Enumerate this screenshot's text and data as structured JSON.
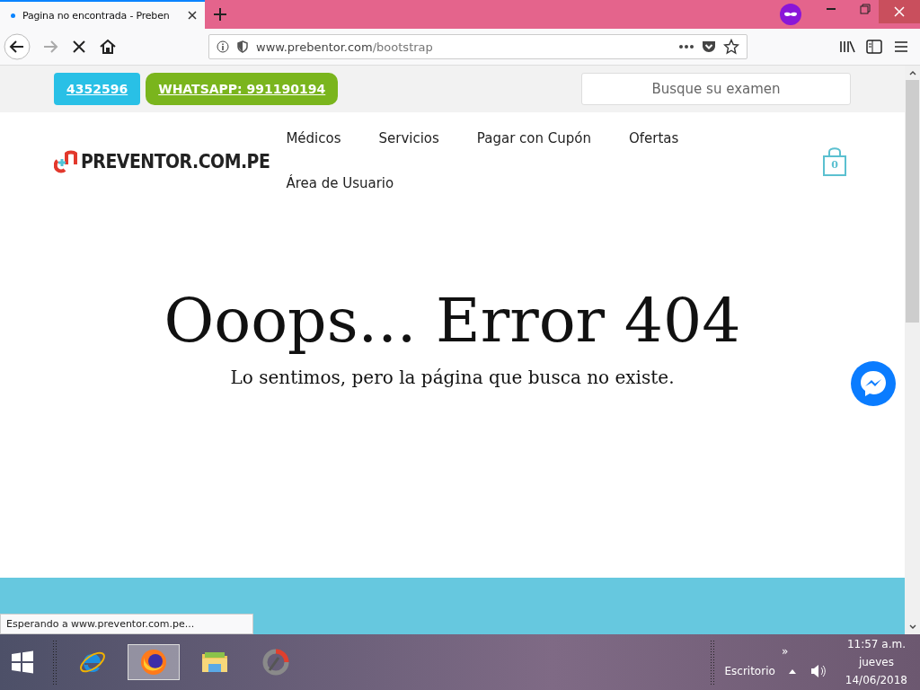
{
  "browser": {
    "tab": {
      "title": "Pagina no encontrada - Preben",
      "selected": true
    },
    "url": {
      "domain": "www.prebentor.com",
      "path": "/bootstrap"
    },
    "status": "Esperando a www.preventor.com.pe..."
  },
  "page": {
    "contact_buttons": [
      {
        "label": "4352596",
        "color": "#29c0e6"
      },
      {
        "label": "WHATSAPP: 991190194",
        "color": "#7ab51d"
      }
    ],
    "search": {
      "placeholder": "Busque su examen"
    },
    "logo": "PREVENTOR.COM.PE",
    "nav": [
      "Médicos",
      "Servicios",
      "Pagar con Cupón",
      "Ofertas",
      "Área de Usuario"
    ],
    "cart_count": "0",
    "error": {
      "title": "Ooops... Error 404",
      "message": "Lo sentimos, pero la página que busca no existe."
    }
  },
  "taskbar": {
    "apps": [
      {
        "kind": "ie",
        "selected": false
      },
      {
        "kind": "firefox",
        "selected": true
      },
      {
        "kind": "explorer",
        "selected": false
      },
      {
        "kind": "recorder",
        "selected": false
      }
    ],
    "tray": {
      "overflow": "»",
      "toolbar": "Escritorio",
      "time": "11:57 a.m.",
      "day": "jueves",
      "date": "14/06/2018"
    }
  }
}
